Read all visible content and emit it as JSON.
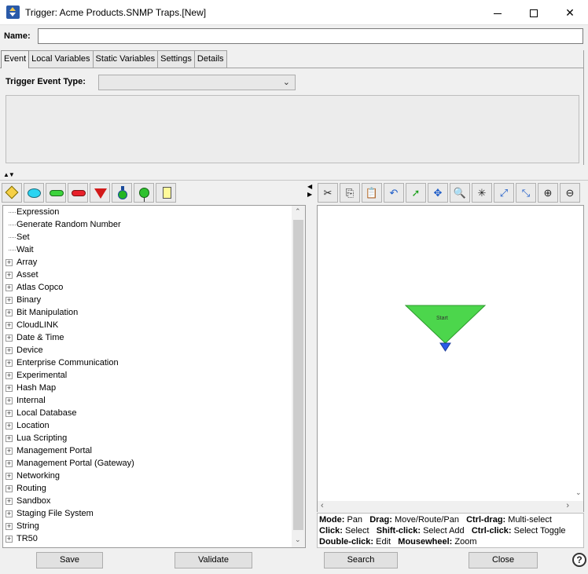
{
  "window": {
    "title": "Trigger:  Acme Products.SNMP Traps.[New]",
    "min_glyph": "—",
    "max_glyph": "☐",
    "close_glyph": "✕"
  },
  "name_field": {
    "label": "Name:",
    "value": "",
    "placeholder": ""
  },
  "tabs": [
    "Event",
    "Local Variables",
    "Static Variables",
    "Settings",
    "Details"
  ],
  "active_tab": "Event",
  "event": {
    "type_label": "Trigger Event Type:",
    "type_value": ""
  },
  "palette_icons": [
    "condition-diamond-icon",
    "oval-icon",
    "green-pill-icon",
    "red-pill-icon",
    "red-triangle-icon",
    "bulb-icon",
    "pin-icon",
    "note-icon"
  ],
  "tree": {
    "leaves": [
      "Expression",
      "Generate Random Number",
      "Set",
      "Wait"
    ],
    "groups": [
      "Array",
      "Asset",
      "Atlas Copco",
      "Binary",
      "Bit Manipulation",
      "CloudLINK",
      "Date & Time",
      "Device",
      "Enterprise Communication",
      "Experimental",
      "Hash Map",
      "Internal",
      "Local Database",
      "Location",
      "Lua Scripting",
      "Management Portal",
      "Management Portal (Gateway)",
      "Networking",
      "Routing",
      "Sandbox",
      "Staging File System",
      "String",
      "TR50"
    ]
  },
  "canvas_toolbar": [
    {
      "icon": "cut-icon",
      "glyph": "✂"
    },
    {
      "icon": "copy-icon",
      "glyph": "⎘"
    },
    {
      "icon": "paste-icon",
      "glyph": "📋"
    },
    {
      "icon": "undo-icon",
      "glyph": "↶"
    },
    {
      "icon": "select-arrow-icon",
      "glyph": "➚"
    },
    {
      "icon": "move-icon",
      "glyph": "✥"
    },
    {
      "icon": "zoom-area-icon",
      "glyph": "🔍"
    },
    {
      "icon": "auto-layout-icon",
      "glyph": "✳"
    },
    {
      "icon": "fit-expand-icon",
      "glyph": "⤢"
    },
    {
      "icon": "fit-collapse-icon",
      "glyph": "⤡"
    },
    {
      "icon": "zoom-in-icon",
      "glyph": "⊕"
    },
    {
      "icon": "zoom-out-icon",
      "glyph": "⊖"
    }
  ],
  "canvas": {
    "start_label": "Start"
  },
  "help": {
    "mode_k": "Mode:",
    "mode_v": "Pan",
    "drag_k": "Drag:",
    "drag_v": "Move/Route/Pan",
    "ctrldrag_k": "Ctrl-drag:",
    "ctrldrag_v": "Multi-select",
    "click_k": "Click:",
    "click_v": "Select",
    "shiftclick_k": "Shift-click:",
    "shiftclick_v": "Select Add",
    "ctrlclick_k": "Ctrl-click:",
    "ctrlclick_v": "Select Toggle",
    "dbl_k": "Double-click:",
    "dbl_v": "Edit",
    "wheel_k": "Mousewheel:",
    "wheel_v": "Zoom"
  },
  "buttons": {
    "save": "Save",
    "validate": "Validate",
    "search": "Search",
    "close": "Close",
    "help": "?"
  },
  "colors": {
    "start_fill": "#4cd64c",
    "start_port": "#2a5ae8"
  }
}
